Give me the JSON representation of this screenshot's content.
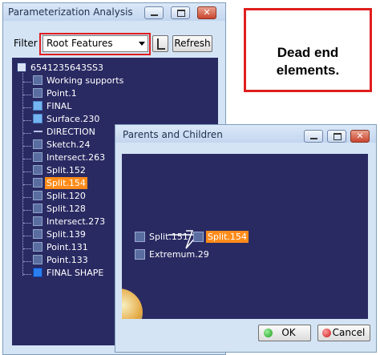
{
  "colors": {
    "accent_selection": "#ff8c1a",
    "tree_background": "#2a2a63",
    "callout_border": "#e01e1e"
  },
  "analysis": {
    "title": "Parameterization Analysis",
    "filter_label": "Filter",
    "filter_value": "Root Features",
    "refresh_label": "Refresh",
    "tree": [
      {
        "label": "6541235643SS3",
        "icon": "part-icon"
      },
      {
        "label": "Working supports",
        "icon": "support-icon"
      },
      {
        "label": "Point.1",
        "icon": "point-icon"
      },
      {
        "label": "FINAL",
        "icon": "surface-icon"
      },
      {
        "label": "Surface.230",
        "icon": "surface-icon"
      },
      {
        "label": "DIRECTION",
        "icon": "direction-icon"
      },
      {
        "label": "Sketch.24",
        "icon": "sketch-icon"
      },
      {
        "label": "Intersect.263",
        "icon": "intersect-icon"
      },
      {
        "label": "Split.152",
        "icon": "split-icon"
      },
      {
        "label": "Split.154",
        "icon": "split-icon"
      },
      {
        "label": "Split.120",
        "icon": "split-icon"
      },
      {
        "label": "Split.128",
        "icon": "split-icon"
      },
      {
        "label": "Intersect.273",
        "icon": "intersect-icon"
      },
      {
        "label": "Split.139",
        "icon": "split-icon"
      },
      {
        "label": "Point.131",
        "icon": "point-icon"
      },
      {
        "label": "Point.133",
        "icon": "point-icon"
      },
      {
        "label": "FINAL SHAPE",
        "icon": "shape-icon"
      }
    ]
  },
  "callout": {
    "line1": "Dead end",
    "line2": "elements."
  },
  "parents": {
    "title": "Parents and Children",
    "nodes": [
      {
        "label": "Split.151"
      },
      {
        "label": "Split.154"
      },
      {
        "label": "Extremum.29"
      }
    ],
    "ok_label": "OK",
    "cancel_label": "Cancel"
  }
}
